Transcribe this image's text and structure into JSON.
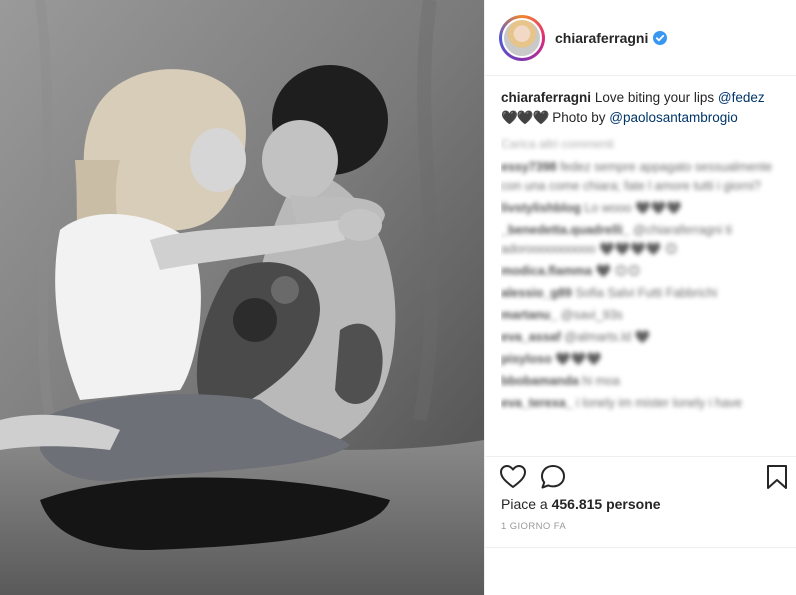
{
  "post": {
    "image_alt": "Black and white photo of couple embracing"
  },
  "header": {
    "username": "chiaraferragni",
    "verified_icon": "verified-badge-icon",
    "avatar_icon": "profile-avatar"
  },
  "caption": {
    "username": "chiaraferragni",
    "text_start": "Love biting your lips",
    "mention_1": "@fedez",
    "hearts": "🖤🖤🖤",
    "photo_by": "Photo by",
    "mention_2": "@paolosantambrogio"
  },
  "comments": {
    "load_more": "Carica altri commenti",
    "items": [
      {
        "user": "essy7398",
        "text": "fedez sempre appagato sessualmente con una come chiara; fate l amore tutti i giorni?"
      },
      {
        "user": "livstylishblog",
        "text": "Lo wooo 🖤🖤🖤"
      },
      {
        "user": "_benedetta.quadrelli_",
        "text": "@chiaraferragni ti adoroooooooooo 🖤🖤🖤🖤 😊"
      },
      {
        "user": "modica.flamma",
        "text": "🖤 😊😊"
      },
      {
        "user": "alessio_g89",
        "text": "Sofia Salvi Futti Fabbrichi"
      },
      {
        "user": "martanu_",
        "text": "@savi_93s"
      },
      {
        "user": "eva_assaf",
        "text": "@almarts.ld 🖤"
      },
      {
        "user": "pisyloso",
        "text": "🖤🖤🖤"
      },
      {
        "user": "bbobamanda",
        "text": "hi moa"
      },
      {
        "user": "eva_terexa_",
        "text": "i lonely im mister lonely i have"
      }
    ]
  },
  "actions": {
    "like_icon": "heart-icon",
    "comment_icon": "comment-icon",
    "save_icon": "bookmark-icon"
  },
  "likes": {
    "prefix": "Piace a",
    "count": "456.815",
    "suffix": "persone"
  },
  "timestamp": "1 GIORNO FA",
  "colors": {
    "mention": "#003569",
    "text": "#262626",
    "muted": "#999999",
    "border": "#efefef"
  }
}
